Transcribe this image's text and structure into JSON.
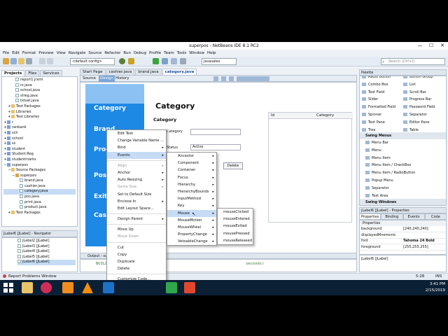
{
  "window": {
    "title": "superpos - NetBeans IDE 8.1 RC2",
    "min": "—",
    "max": "☐",
    "close": "✕"
  },
  "menu": [
    "File",
    "Edit",
    "Format",
    "Preview",
    "View",
    "Navigate",
    "Source",
    "Refactor",
    "Run",
    "Debug",
    "Profile",
    "Team",
    "Tools",
    "Window",
    "Help"
  ],
  "toolbar": {
    "config": "<default config>",
    "target": "javasales",
    "search_placeholder": "Search (Ctrl+I)"
  },
  "left_tabs": [
    "Projects",
    "Files",
    "Services"
  ],
  "tree": [
    {
      "label": "report1.jrxml",
      "indent": 4,
      "type": "file"
    },
    {
      "label": "rs.java",
      "indent": 4,
      "type": "file"
    },
    {
      "label": "school.java",
      "indent": 4,
      "type": "file"
    },
    {
      "label": "streg.java",
      "indent": 4,
      "type": "file"
    },
    {
      "label": "txtsat.java",
      "indent": 4,
      "type": "file"
    },
    {
      "label": "Test Packages",
      "indent": 2,
      "type": "folder",
      "exp": "+"
    },
    {
      "label": "Libraries",
      "indent": 2,
      "type": "folder",
      "exp": "+"
    },
    {
      "label": "Test Libraries",
      "indent": 2,
      "type": "folder",
      "exp": "+"
    },
    {
      "label": "r",
      "indent": 0,
      "type": "proj",
      "exp": "+"
    },
    {
      "label": "ranbank",
      "indent": 0,
      "type": "proj",
      "exp": "+"
    },
    {
      "label": "sch",
      "indent": 0,
      "type": "proj",
      "exp": "+"
    },
    {
      "label": "school",
      "indent": 0,
      "type": "proj",
      "exp": "+"
    },
    {
      "label": "ss",
      "indent": 0,
      "type": "proj",
      "exp": "+"
    },
    {
      "label": "student",
      "indent": 0,
      "type": "proj",
      "exp": "+"
    },
    {
      "label": "Student.Reg",
      "indent": 0,
      "type": "proj",
      "exp": "+"
    },
    {
      "label": "studentmarks",
      "indent": 0,
      "type": "proj",
      "exp": "+"
    },
    {
      "label": "superpos",
      "indent": 0,
      "type": "proj",
      "exp": "−"
    },
    {
      "label": "Source Packages",
      "indent": 2,
      "type": "folder",
      "exp": "−"
    },
    {
      "label": "superpos",
      "indent": 4,
      "type": "pkg",
      "exp": "−"
    },
    {
      "label": "brand.java",
      "indent": 6,
      "type": "file"
    },
    {
      "label": "cashier.java",
      "indent": 6,
      "type": "file"
    },
    {
      "label": "category.java",
      "indent": 6,
      "type": "file",
      "selected": true
    },
    {
      "label": "pos.java",
      "indent": 6,
      "type": "file"
    },
    {
      "label": "print.java",
      "indent": 6,
      "type": "file"
    },
    {
      "label": "product.java",
      "indent": 6,
      "type": "file"
    },
    {
      "label": "Test Packages",
      "indent": 2,
      "type": "folder",
      "exp": "+"
    }
  ],
  "navigator": {
    "title": "jLabel6 [JLabel] - Navigator",
    "items": [
      "jLabel2 [JLabel]",
      "jLabel3 [JLabel]",
      "jLabel4 [JLabel]",
      "jLabel5 [JLabel]",
      "jLabel6 [JLabel]"
    ]
  },
  "editor_tabs": [
    "Start Page",
    "cashier.java",
    "brand.java",
    "category.java"
  ],
  "editor_view_tabs": [
    "Source",
    "Design",
    "History"
  ],
  "form": {
    "sidebar_labels": [
      "Category",
      "Brand",
      "Product",
      "Pos",
      "Exit",
      "Cashier"
    ],
    "heading": "Category",
    "subheading": "Category",
    "field_label": "Category",
    "status_label": "Status",
    "status_value": "Active",
    "delete_label": "Delete",
    "table_headers": [
      "Id",
      "Category"
    ]
  },
  "context_menu": [
    {
      "label": "Edit Text"
    },
    {
      "label": "Change Variable Name ..."
    },
    {
      "label": "Bind",
      "sub": true
    },
    {
      "label": "Events",
      "sub": true,
      "hl": true
    },
    {
      "sep": true
    },
    {
      "label": "Align",
      "dis": true,
      "sub": true
    },
    {
      "label": "Anchor",
      "sub": true
    },
    {
      "label": "Auto Resizing",
      "sub": true
    },
    {
      "label": "Same Size",
      "dis": true,
      "sub": true
    },
    {
      "label": "Set to Default Size"
    },
    {
      "label": "Enclose In",
      "sub": true
    },
    {
      "label": "Edit Layout Space..."
    },
    {
      "sep": true
    },
    {
      "label": "Design Parent",
      "sub": true
    },
    {
      "sep": true
    },
    {
      "label": "Move Up"
    },
    {
      "label": "Move Down",
      "dis": true
    },
    {
      "sep": true
    },
    {
      "label": "Cut"
    },
    {
      "label": "Copy"
    },
    {
      "label": "Duplicate"
    },
    {
      "label": "Delete"
    },
    {
      "sep": true
    },
    {
      "label": "Customize Code..."
    },
    {
      "sep": true
    },
    {
      "label": "Properties"
    }
  ],
  "events_menu": [
    "Ancestor",
    "Component",
    "Container",
    "Focus",
    "Hierarchy",
    "HierarchyBounds",
    "InputMethod",
    "Key",
    "Mouse",
    "MouseMotion",
    "MouseWheel",
    "PropertyChange",
    "VetoableChange"
  ],
  "mouse_menu": [
    "mouseClicked",
    "mouseEntered",
    "mouseExited",
    "mousePressed",
    "mouseReleased"
  ],
  "palette": {
    "title": "Palette",
    "left": [
      "Radio Button",
      "Combo Box",
      "Text Field",
      "Slider",
      "Formatted Field",
      "Spinner",
      "Text Pane",
      "Tree"
    ],
    "right": [
      "Button Group",
      "List",
      "Scroll Bar",
      "Progress Bar",
      "Password Field",
      "Separator",
      "Editor Pane",
      "Table"
    ],
    "swing_menus": "Swing Menus",
    "menus": [
      "Menu Bar",
      "Menu",
      "Menu Item",
      "Menu Item / CheckBox",
      "Menu Item / RadioButton",
      "Popup Menu",
      "Separator",
      "Text Area"
    ],
    "swing_windows": "Swing Windows"
  },
  "properties": {
    "title": "jLabel6 [JLabel] - Properties",
    "tabs": [
      "Properties",
      "Binding",
      "Events",
      "Code"
    ],
    "section": "Properties",
    "rows": [
      {
        "name": "background",
        "value": "[240,240,240]"
      },
      {
        "name": "displayedMnemonic",
        "value": ""
      },
      {
        "name": "font",
        "value": "Tahoma 24 Bold"
      },
      {
        "name": "foreground",
        "value": "[255,255,255]"
      }
    ],
    "footer": "jLabel6 [JLabel]"
  },
  "output": {
    "title": "Output - superpos (run)",
    "line1": "BUILD",
    "line2": "seconds)"
  },
  "status": {
    "report": "Report Problems Window",
    "pos": "5:28",
    "ins": "INS"
  },
  "clock": {
    "time": "3:41 PM",
    "date": "2/15/2019"
  },
  "colors": {
    "form_blue": "#1e88e5",
    "taskbar": "#0b1f35"
  }
}
